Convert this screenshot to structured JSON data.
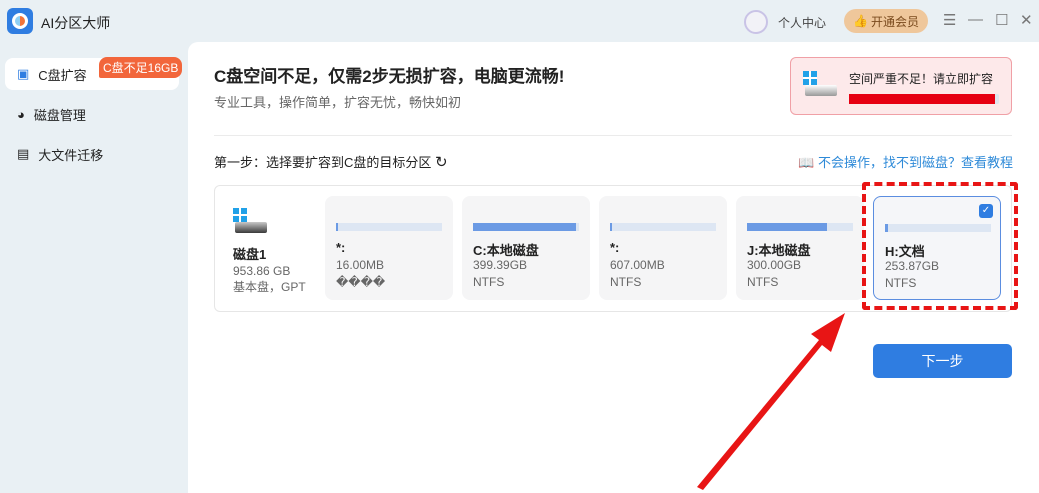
{
  "app": {
    "title": "AI分区大师",
    "user_center": "个人中心",
    "vip_button": "开通会员"
  },
  "sidebar": {
    "items": [
      {
        "label": "C盘扩容",
        "badge": "C盘不足16GB"
      },
      {
        "label": "磁盘管理"
      },
      {
        "label": "大文件迁移"
      }
    ]
  },
  "main": {
    "title": "C盘空间不足，仅需2步无损扩容，电脑更流畅!",
    "subtitle": "专业工具，操作简单，扩容无忧，畅快如初",
    "alert": {
      "text": "空间严重不足！请立即扩容",
      "usage_percent": 97
    },
    "step_label": "第一步：选择要扩容到C盘的目标分区",
    "help_link": "不会操作，找不到磁盘？查看教程",
    "disk": {
      "name": "磁盘1",
      "size": "953.86 GB",
      "type": "基本盘，GPT"
    },
    "partitions": [
      {
        "name": "*:",
        "size": "16.00MB",
        "fs": "����",
        "usage_percent": 0
      },
      {
        "name": "C:本地磁盘",
        "size": "399.39GB",
        "fs": "NTFS",
        "usage_percent": 97
      },
      {
        "name": "*:",
        "size": "607.00MB",
        "fs": "NTFS",
        "usage_percent": 2
      },
      {
        "name": "J:本地磁盘",
        "size": "300.00GB",
        "fs": "NTFS",
        "usage_percent": 75
      },
      {
        "name": "H:文档",
        "size": "253.87GB",
        "fs": "NTFS",
        "usage_percent": 3,
        "selected": true
      }
    ],
    "next_button": "下一步"
  }
}
